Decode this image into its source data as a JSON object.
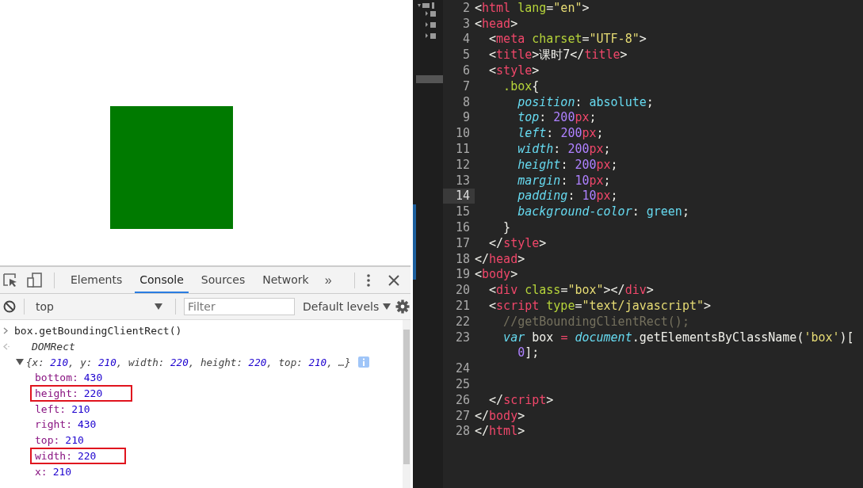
{
  "devtools": {
    "tabs": [
      {
        "label": "Elements",
        "selected": false
      },
      {
        "label": "Console",
        "selected": true
      },
      {
        "label": "Sources",
        "selected": false
      },
      {
        "label": "Network",
        "selected": false
      }
    ],
    "overflow": "»",
    "console_toolbar": {
      "context": "top",
      "filter": {
        "placeholder": "Filter"
      },
      "levels": "Default levels"
    },
    "console": {
      "input": "box.getBoundingClientRect()",
      "result": {
        "type": "DOMRect",
        "expanded": true,
        "preview": [
          {
            "text": "{x: ",
            "kind": "key"
          },
          {
            "text": "210",
            "kind": "number"
          },
          {
            "text": ", y: ",
            "kind": "key"
          },
          {
            "text": "210",
            "kind": "number"
          },
          {
            "text": ", width: ",
            "kind": "key"
          },
          {
            "text": "220",
            "kind": "number"
          },
          {
            "text": ", height: ",
            "kind": "key"
          },
          {
            "text": "220",
            "kind": "number"
          },
          {
            "text": ", top: ",
            "kind": "key"
          },
          {
            "text": "210",
            "kind": "number"
          },
          {
            "text": ", …}",
            "kind": "key"
          }
        ],
        "properties": [
          {
            "name": "bottom:",
            "value": "430",
            "boxed": false
          },
          {
            "name": "height:",
            "value": "220",
            "boxed": true
          },
          {
            "name": "left:",
            "value": "210",
            "boxed": false
          },
          {
            "name": "right:",
            "value": "430",
            "boxed": false
          },
          {
            "name": "top:",
            "value": "210",
            "boxed": false
          },
          {
            "name": "width:",
            "value": "220",
            "boxed": true
          },
          {
            "name": "x:",
            "value": "210",
            "boxed": false
          }
        ]
      }
    }
  },
  "editor": {
    "lines": [
      {
        "number": "2",
        "current": false,
        "tokens": [
          {
            "text": "<",
            "kind": "punct"
          },
          {
            "text": "html",
            "kind": "tag"
          },
          {
            "text": " lang",
            "kind": "attr"
          },
          {
            "text": "=",
            "kind": "punct"
          },
          {
            "text": "\"en\"",
            "kind": "string"
          },
          {
            "text": ">",
            "kind": "punct"
          }
        ]
      },
      {
        "number": "3",
        "current": false,
        "tokens": [
          {
            "text": "<",
            "kind": "punct"
          },
          {
            "text": "head",
            "kind": "tag"
          },
          {
            "text": ">",
            "kind": "punct"
          }
        ]
      },
      {
        "number": "4",
        "current": false,
        "tokens": [
          {
            "text": "  <",
            "kind": "punct"
          },
          {
            "text": "meta",
            "kind": "tag"
          },
          {
            "text": " charset",
            "kind": "attr"
          },
          {
            "text": "=",
            "kind": "punct"
          },
          {
            "text": "\"UTF-8\"",
            "kind": "string"
          },
          {
            "text": ">",
            "kind": "punct"
          }
        ]
      },
      {
        "number": "5",
        "current": false,
        "tokens": [
          {
            "text": "  <",
            "kind": "punct"
          },
          {
            "text": "title",
            "kind": "tag"
          },
          {
            "text": ">课时7</",
            "kind": "punct"
          },
          {
            "text": "title",
            "kind": "tag"
          },
          {
            "text": ">",
            "kind": "punct"
          }
        ]
      },
      {
        "number": "6",
        "current": false,
        "tokens": [
          {
            "text": "  <",
            "kind": "punct"
          },
          {
            "text": "style",
            "kind": "tag"
          },
          {
            "text": ">",
            "kind": "punct"
          }
        ]
      },
      {
        "number": "7",
        "current": false,
        "tokens": [
          {
            "text": "    .box",
            "kind": "attr"
          },
          {
            "text": "{",
            "kind": "punct"
          }
        ]
      },
      {
        "number": "8",
        "current": false,
        "tokens": [
          {
            "text": "      position",
            "kind": "prop"
          },
          {
            "text": ": ",
            "kind": "punct"
          },
          {
            "text": "absolute",
            "kind": "value"
          },
          {
            "text": ";",
            "kind": "punct"
          }
        ]
      },
      {
        "number": "9",
        "current": false,
        "tokens": [
          {
            "text": "      top",
            "kind": "prop"
          },
          {
            "text": ": ",
            "kind": "punct"
          },
          {
            "text": "200",
            "kind": "number"
          },
          {
            "text": "px",
            "kind": "unit"
          },
          {
            "text": ";",
            "kind": "punct"
          }
        ]
      },
      {
        "number": "10",
        "current": false,
        "tokens": [
          {
            "text": "      left",
            "kind": "prop"
          },
          {
            "text": ": ",
            "kind": "punct"
          },
          {
            "text": "200",
            "kind": "number"
          },
          {
            "text": "px",
            "kind": "unit"
          },
          {
            "text": ";",
            "kind": "punct"
          }
        ]
      },
      {
        "number": "11",
        "current": false,
        "tokens": [
          {
            "text": "      width",
            "kind": "prop"
          },
          {
            "text": ": ",
            "kind": "punct"
          },
          {
            "text": "200",
            "kind": "number"
          },
          {
            "text": "px",
            "kind": "unit"
          },
          {
            "text": ";",
            "kind": "punct"
          }
        ]
      },
      {
        "number": "12",
        "current": false,
        "tokens": [
          {
            "text": "      height",
            "kind": "prop"
          },
          {
            "text": ": ",
            "kind": "punct"
          },
          {
            "text": "200",
            "kind": "number"
          },
          {
            "text": "px",
            "kind": "unit"
          },
          {
            "text": ";",
            "kind": "punct"
          }
        ]
      },
      {
        "number": "13",
        "current": false,
        "tokens": [
          {
            "text": "      margin",
            "kind": "prop"
          },
          {
            "text": ": ",
            "kind": "punct"
          },
          {
            "text": "10",
            "kind": "number"
          },
          {
            "text": "px",
            "kind": "unit"
          },
          {
            "text": ";",
            "kind": "punct"
          }
        ]
      },
      {
        "number": "14",
        "current": true,
        "tokens": [
          {
            "text": "      padding",
            "kind": "prop"
          },
          {
            "text": ": ",
            "kind": "punct"
          },
          {
            "text": "10",
            "kind": "number"
          },
          {
            "text": "px",
            "kind": "unit"
          },
          {
            "text": ";",
            "kind": "punct"
          }
        ]
      },
      {
        "number": "15",
        "current": false,
        "tokens": [
          {
            "text": "      background-color",
            "kind": "prop"
          },
          {
            "text": ": ",
            "kind": "punct"
          },
          {
            "text": "green",
            "kind": "value"
          },
          {
            "text": ";",
            "kind": "punct"
          }
        ]
      },
      {
        "number": "16",
        "current": false,
        "tokens": [
          {
            "text": "    }",
            "kind": "punct"
          }
        ]
      },
      {
        "number": "17",
        "current": false,
        "tokens": [
          {
            "text": "  </",
            "kind": "punct"
          },
          {
            "text": "style",
            "kind": "tag"
          },
          {
            "text": ">",
            "kind": "punct"
          }
        ]
      },
      {
        "number": "18",
        "current": false,
        "tokens": [
          {
            "text": "</",
            "kind": "punct"
          },
          {
            "text": "head",
            "kind": "tag"
          },
          {
            "text": ">",
            "kind": "punct"
          }
        ]
      },
      {
        "number": "19",
        "current": false,
        "tokens": [
          {
            "text": "<",
            "kind": "punct"
          },
          {
            "text": "body",
            "kind": "tag"
          },
          {
            "text": ">",
            "kind": "punct"
          }
        ]
      },
      {
        "number": "20",
        "current": false,
        "tokens": [
          {
            "text": "  <",
            "kind": "punct"
          },
          {
            "text": "div",
            "kind": "tag"
          },
          {
            "text": " class",
            "kind": "attr"
          },
          {
            "text": "=",
            "kind": "punct"
          },
          {
            "text": "\"box\"",
            "kind": "string"
          },
          {
            "text": "></",
            "kind": "punct"
          },
          {
            "text": "div",
            "kind": "tag"
          },
          {
            "text": ">",
            "kind": "punct"
          }
        ]
      },
      {
        "number": "21",
        "current": false,
        "tokens": [
          {
            "text": "  <",
            "kind": "punct"
          },
          {
            "text": "script",
            "kind": "tag"
          },
          {
            "text": " type",
            "kind": "attr"
          },
          {
            "text": "=",
            "kind": "punct"
          },
          {
            "text": "\"text/javascript\"",
            "kind": "string"
          },
          {
            "text": ">",
            "kind": "punct"
          }
        ]
      },
      {
        "number": "22",
        "current": false,
        "tokens": [
          {
            "text": "    //getBoundingClientRect();",
            "kind": "comment"
          }
        ]
      },
      {
        "number": "23",
        "current": false,
        "tokens": [
          {
            "text": "    var",
            "kind": "keyword"
          },
          {
            "text": " box ",
            "kind": "punct"
          },
          {
            "text": "=",
            "kind": "unit"
          },
          {
            "text": " document",
            "kind": "keyword"
          },
          {
            "text": ".getElementsByClassName(",
            "kind": "punct"
          },
          {
            "text": "'box'",
            "kind": "string"
          },
          {
            "text": ")[",
            "kind": "punct"
          }
        ],
        "continuation": [
          {
            "text": "      0",
            "kind": "number"
          },
          {
            "text": "];",
            "kind": "punct"
          }
        ]
      },
      {
        "number": "24",
        "current": false
      },
      {
        "number": "25",
        "current": false
      },
      {
        "number": "26",
        "current": false,
        "tokens": [
          {
            "text": "  </",
            "kind": "punct"
          },
          {
            "text": "script",
            "kind": "tag"
          },
          {
            "text": ">",
            "kind": "punct"
          }
        ]
      },
      {
        "number": "27",
        "current": false,
        "tokens": [
          {
            "text": "</",
            "kind": "punct"
          },
          {
            "text": "body",
            "kind": "tag"
          },
          {
            "text": ">",
            "kind": "punct"
          }
        ]
      },
      {
        "number": "28",
        "current": false,
        "tokens": [
          {
            "text": "</",
            "kind": "punct"
          },
          {
            "text": "html",
            "kind": "tag"
          },
          {
            "text": ">",
            "kind": "punct"
          }
        ]
      }
    ]
  }
}
